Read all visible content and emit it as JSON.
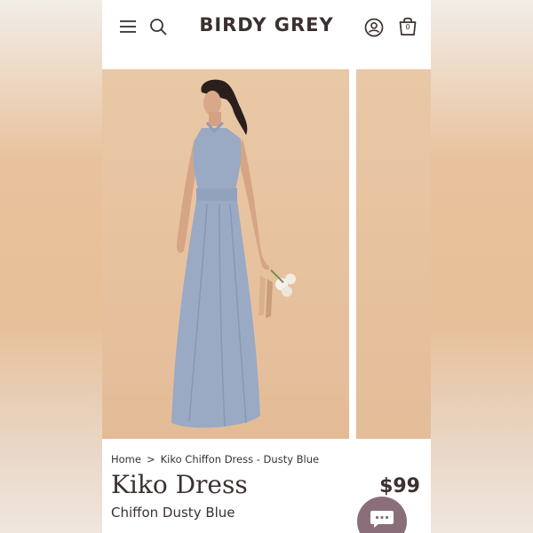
{
  "header": {
    "brand": "BIRDY GREY",
    "cart_count": "0"
  },
  "icons": {
    "menu": "menu-icon",
    "search": "search-icon",
    "account": "account-icon",
    "cart": "cart-icon",
    "chat": "chat-icon"
  },
  "breadcrumb": {
    "home": "Home",
    "separator": ">",
    "current": "Kiko Chiffon Dress - Dusty Blue"
  },
  "product": {
    "name": "Kiko Dress",
    "price": "$99",
    "color": "Chiffon Dusty Blue"
  },
  "colors": {
    "text": "#3b3130",
    "dress": "#9aaac5",
    "chat_button": "#8a6f7a",
    "background": "#e7c29f"
  }
}
